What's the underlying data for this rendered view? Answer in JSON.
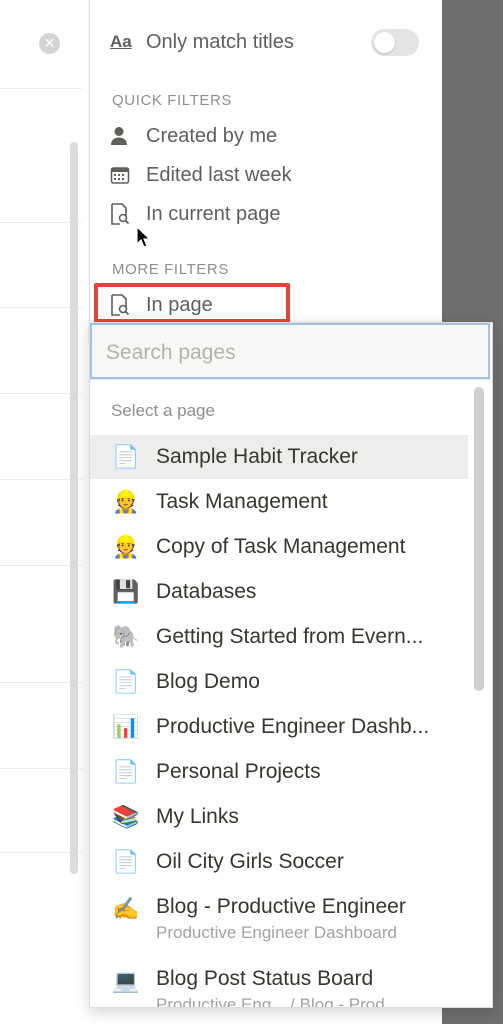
{
  "filters": {
    "only_match_titles_label": "Only match titles",
    "only_match_titles_icon": "Aa",
    "quick_filters_heading": "QUICK FILTERS",
    "quick": [
      {
        "icon": "person-icon",
        "label": "Created by me"
      },
      {
        "icon": "calendar-icon",
        "label": "Edited last week"
      },
      {
        "icon": "page-search-icon",
        "label": "In current page"
      }
    ],
    "more_filters_heading": "MORE FILTERS",
    "in_page_label": "In page"
  },
  "picker": {
    "search_placeholder": "Search pages",
    "select_label": "Select a page",
    "items": [
      {
        "icon": "📄",
        "title": "Sample Habit Tracker"
      },
      {
        "icon": "👷",
        "title": "Task Management"
      },
      {
        "icon": "👷",
        "title": "Copy of Task Management"
      },
      {
        "icon": "💾",
        "title": "Databases"
      },
      {
        "icon": "🐘",
        "title": "Getting Started from Evern..."
      },
      {
        "icon": "📄",
        "title": "Blog Demo"
      },
      {
        "icon": "📊",
        "title": "Productive Engineer Dashb..."
      },
      {
        "icon": "📄",
        "title": "Personal Projects"
      },
      {
        "icon": "📚",
        "title": "My Links"
      },
      {
        "icon": "📄",
        "title": "Oil City Girls Soccer"
      },
      {
        "icon": "✍",
        "title": "Blog - Productive Engineer",
        "subtitle": "Productive Engineer Dashboard"
      },
      {
        "icon": "💻",
        "title": "Blog Post Status Board",
        "subtitle": "Productive Eng... / Blog - Prod..."
      }
    ]
  },
  "colors": {
    "highlight": "#e0453a",
    "focus_border": "#9fc3e4"
  }
}
